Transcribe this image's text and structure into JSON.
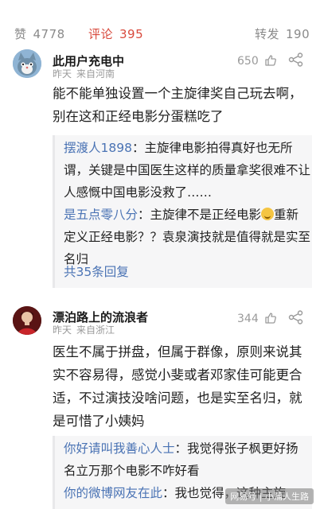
{
  "tabs": {
    "likes_label": "赞",
    "likes_count": "4778",
    "comments_label": "评论",
    "comments_count": "395",
    "reposts_label": "转发",
    "reposts_count": "190"
  },
  "comments": [
    {
      "username": "此用户充电中",
      "time": "昨天",
      "location": "来自河南",
      "likes": "650",
      "text": "能不能单独设置一个主旋律奖自己玩去啊，别在这和正经电影分蛋糕吃了",
      "replies": [
        {
          "name": "摆渡人1898",
          "sep": "：",
          "text": "主旋律电影拍得真好也无所谓，关键是中国医生这样的质量拿奖很难不让人感慨中国电影没救了……"
        },
        {
          "name": "是五点零八分",
          "sep": "：",
          "text_a": "主旋律不是正经电影",
          "text_b": "重新定义正经电影？？袁泉演技就是值得就是实至名归"
        }
      ],
      "more": "共35条回复"
    },
    {
      "username": "漂泊路上的流浪者",
      "time": "昨天",
      "location": "来自浙江",
      "likes": "344",
      "text": "医生不属于拼盘，但属于群像，原则来说其实不容易得，感觉小斐或者邓家佳可能更合适，不过演技没啥问题，也是实至名归，就是可惜了小姨妈",
      "replies": [
        {
          "name": "你好请叫我善心人士",
          "sep": "：",
          "text": "我觉得张子枫更好扬名立万那个电影不咋好看"
        },
        {
          "name": "你的微博网友在此",
          "sep": "：",
          "text": "我也觉得，这种主旋"
        }
      ]
    }
  ],
  "watermark": "网易号 | 小蒲人生路",
  "colors": {
    "accent": "#d84a3d",
    "link": "#4a73b4",
    "muted": "#9a9a9a"
  },
  "icons": {
    "like": "thumbs-up-icon",
    "share": "share-icon"
  }
}
